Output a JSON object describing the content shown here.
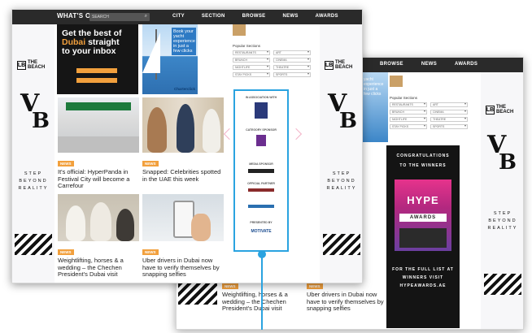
{
  "nav": {
    "logo": "WHAT'S ON",
    "search_placeholder": "SEARCH",
    "items": [
      "CITY",
      "SECTION",
      "BROWSE",
      "NEWS",
      "AWARDS"
    ]
  },
  "back_nav": {
    "items": [
      "BROWSE",
      "NEWS",
      "AWARDS"
    ]
  },
  "sidebar_ad": {
    "beach_mark": "LB",
    "beach_text_1": "THE",
    "beach_text_2": "BEACH",
    "vb_v": "V",
    "vb_b": "B",
    "step_lines": [
      "STEP",
      "BEYOND",
      "REALITY"
    ]
  },
  "newsletter": {
    "line1": "Get the best of",
    "line2_highlight": "Dubai",
    "line2_rest": "straight",
    "line3": "to your inbox"
  },
  "boat_ad": {
    "text_lines": [
      "Book your",
      "yacht",
      "experience",
      "in just a",
      "few clicks"
    ],
    "brand": "Charterclick",
    "back_text_lines": [
      "yacht",
      "experience",
      "in just a",
      "few clicks"
    ]
  },
  "popular_sections": {
    "title": "Popular Sections",
    "rows": [
      [
        "RESTAURANTS",
        "ART"
      ],
      [
        "BRUNCH",
        "CINEMA"
      ],
      [
        "NIGHTLIFE",
        "THEATRE"
      ],
      [
        "STAY PICKS",
        "SPORTS"
      ]
    ]
  },
  "cards": [
    {
      "tag": "NEWS",
      "title": "It's official: HyperPanda in Festival City will become a Carrefour"
    },
    {
      "tag": "NEWS",
      "title": "Snapped: Celebrities spotted in the UAE this week"
    },
    {
      "tag": "NEWS",
      "title": "Weightlifting, horses & a wedding – the Chechen President's Dubai visit"
    },
    {
      "tag": "NEWS",
      "title": "Uber drivers in Dubai now have to verify themselves by snapping selfies"
    }
  ],
  "back_cards": [
    {
      "tag": "NEWS",
      "title": "Weightlifting, horses & a wedding – the Chechen President's Dubai visit"
    },
    {
      "tag": "NEWS",
      "title": "Uber drivers in Dubai now have to verify themselves by snapping selfies"
    }
  ],
  "sponsors": {
    "labels": [
      "IN ASSOCIATION WITH",
      "CATEGORY SPONSOR",
      "MEDIA SPONSOR",
      "OFFICIAL PARTNER",
      "PRESENTED BY"
    ],
    "brand": "MOTIVATE"
  },
  "awards_poster": {
    "line1": "CONGRATULATIONS",
    "line2": "TO THE WINNERS",
    "hype": "HYPE",
    "awards": "AWARDS",
    "cta1": "FOR THE FULL LIST AT",
    "cta2": "WINNERS VISIT",
    "cta3": "HYPEAWARDS.AE"
  },
  "colors": {
    "accent": "#f2a03d",
    "highlight": "#2aa3e0",
    "topbar": "#2a2a2a"
  }
}
